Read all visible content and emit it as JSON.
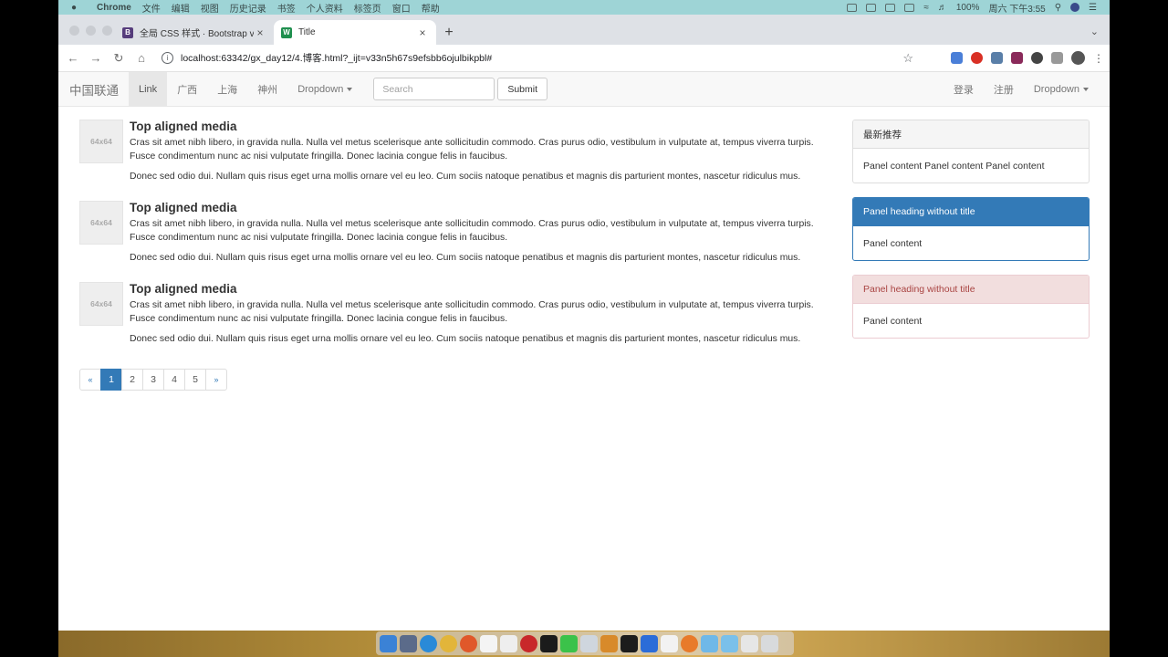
{
  "menubar": {
    "app": "Chrome",
    "items": [
      "文件",
      "编辑",
      "视图",
      "历史记录",
      "书签",
      "个人资料",
      "标签页",
      "窗口",
      "帮助"
    ],
    "battery": "100%",
    "datetime": "周六 下午3:55"
  },
  "browser": {
    "tabs": [
      {
        "label": "全局 CSS 样式 · Bootstrap v3...",
        "favicon": "B"
      },
      {
        "label": "Title",
        "favicon": "W"
      }
    ],
    "url": "localhost:63342/gx_day12/4.博客.html?_ijt=v33n5h67s9efsbb6ojulbikpbl#"
  },
  "navbar": {
    "brand": "中国联通",
    "links": [
      "Link",
      "广西",
      "上海",
      "神州"
    ],
    "dropdown": "Dropdown",
    "search_placeholder": "Search",
    "submit": "Submit",
    "right_links": [
      "登录",
      "注册"
    ],
    "right_dropdown": "Dropdown"
  },
  "media": [
    {
      "thumb": "64x64",
      "heading": "Top aligned media",
      "p1": "Cras sit amet nibh libero, in gravida nulla. Nulla vel metus scelerisque ante sollicitudin commodo. Cras purus odio, vestibulum in vulputate at, tempus viverra turpis. Fusce condimentum nunc ac nisi vulputate fringilla. Donec lacinia congue felis in faucibus.",
      "p2": "Donec sed odio dui. Nullam quis risus eget urna mollis ornare vel eu leo. Cum sociis natoque penatibus et magnis dis parturient montes, nascetur ridiculus mus."
    },
    {
      "thumb": "64x64",
      "heading": "Top aligned media",
      "p1": "Cras sit amet nibh libero, in gravida nulla. Nulla vel metus scelerisque ante sollicitudin commodo. Cras purus odio, vestibulum in vulputate at, tempus viverra turpis. Fusce condimentum nunc ac nisi vulputate fringilla. Donec lacinia congue felis in faucibus.",
      "p2": "Donec sed odio dui. Nullam quis risus eget urna mollis ornare vel eu leo. Cum sociis natoque penatibus et magnis dis parturient montes, nascetur ridiculus mus."
    },
    {
      "thumb": "64x64",
      "heading": "Top aligned media",
      "p1": "Cras sit amet nibh libero, in gravida nulla. Nulla vel metus scelerisque ante sollicitudin commodo. Cras purus odio, vestibulum in vulputate at, tempus viverra turpis. Fusce condimentum nunc ac nisi vulputate fringilla. Donec lacinia congue felis in faucibus.",
      "p2": "Donec sed odio dui. Nullam quis risus eget urna mollis ornare vel eu leo. Cum sociis natoque penatibus et magnis dis parturient montes, nascetur ridiculus mus."
    }
  ],
  "pagination": {
    "prev": "«",
    "pages": [
      "1",
      "2",
      "3",
      "4",
      "5"
    ],
    "next": "»",
    "active_page": "1"
  },
  "panels": [
    {
      "heading": "最新推荐",
      "content": "Panel content Panel content Panel content",
      "style": "default"
    },
    {
      "heading": "Panel heading without title",
      "content": "Panel content",
      "style": "primary"
    },
    {
      "heading": "Panel heading without title",
      "content": "Panel content",
      "style": "danger"
    }
  ],
  "colors": {
    "primary": "#337ab7",
    "danger_bg": "#f2dede",
    "danger_text": "#a94442",
    "menubar": "#9ed4d6"
  }
}
